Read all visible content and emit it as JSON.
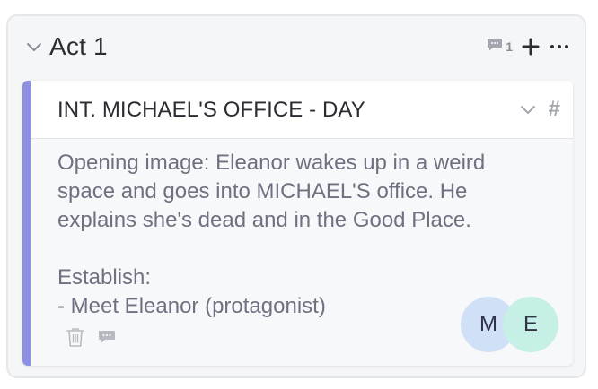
{
  "act": {
    "title": "Act 1",
    "comment_count": "1"
  },
  "scene": {
    "heading": "INT. MICHAEL'S OFFICE - DAY",
    "hash_label": "#",
    "body": "Opening image: Eleanor wakes up in a weird\nspace and goes into MICHAEL'S office. He\nexplains she's dead and in the Good Place.\n\nEstablish:\n- Meet Eleanor (protagonist)",
    "accent_color": "#8d8fe0"
  },
  "collaborators": [
    {
      "initial": "M",
      "color": "#cfe0f7"
    },
    {
      "initial": "E",
      "color": "#c6efe5"
    }
  ],
  "icons": {
    "act_collapse": "chevron-down-icon",
    "comment": "comment-icon",
    "add": "plus-icon",
    "more": "more-horizontal-icon",
    "scene_collapse": "chevron-down-icon",
    "delete": "trash-icon",
    "scene_comment": "comment-icon"
  }
}
